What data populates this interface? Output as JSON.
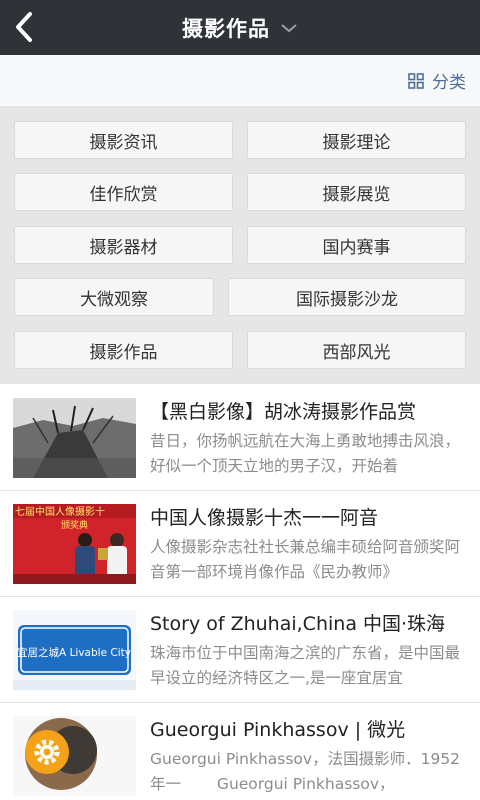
{
  "header": {
    "title": "摄影作品",
    "back_icon": "chevron-left-icon",
    "dropdown_icon": "chevron-down-icon",
    "bg_color": "#2f3338"
  },
  "classbar": {
    "label": "分类",
    "icon": "grid-icon",
    "accent_color": "#4c6f98"
  },
  "categories": [
    "摄影资讯",
    "摄影理论",
    "佳作欣赏",
    "摄影展览",
    "摄影器材",
    "国内赛事",
    "大微观察",
    "国际摄影沙龙",
    "摄影作品",
    "西部风光"
  ],
  "articles": [
    {
      "title": "【黑白影像】胡冰涛摄影作品赏",
      "desc": "昔日，你扬帆远航在大海上勇敢地搏击风浪，好似一个顶天立地的男子汉，开始着"
    },
    {
      "title": "中国人像摄影十杰一一阿音",
      "desc": "人像摄影杂志社社长兼总编丰硕给阿音颁奖阿音第一部环境肖像作品《民办教师》",
      "thumb_banner_text": "七届中国人像摄影十",
      "thumb_banner_text2": "颁奖典"
    },
    {
      "title": "Story of Zhuhai,China 中国·珠海",
      "desc": "珠海市位于中国南海之滨的广东省，是中国最早设立的经济特区之一,是一座宜居宜",
      "thumb_sign_text": "宜居之城A Livable City"
    },
    {
      "title": "Gueorgui Pinkhassov | 微光",
      "desc": "Gueorgui Pinkhassov，法国摄影师．1952年一　　 Gueorgui Pinkhassov，",
      "thumb_icon": "gear-icon"
    }
  ]
}
